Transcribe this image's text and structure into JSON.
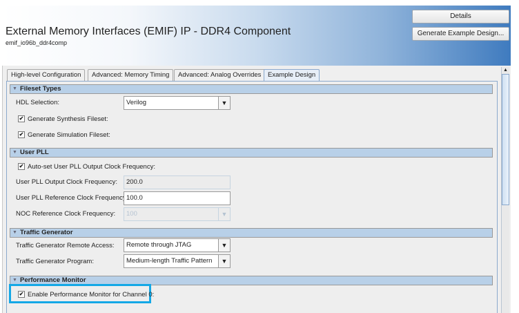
{
  "header": {
    "title": "External Memory Interfaces (EMIF) IP - DDR4 Component",
    "subtitle": "emif_io96b_ddr4comp",
    "details_button": "Details",
    "generate_button": "Generate Example Design..."
  },
  "tabs": [
    {
      "label": "High-level Configuration"
    },
    {
      "label": "Advanced: Memory Timing"
    },
    {
      "label": "Advanced: Analog Overrides"
    },
    {
      "label": "Example Design",
      "active": true
    }
  ],
  "sections": {
    "fileset": {
      "title": "Fileset Types",
      "hdl_label": "HDL Selection:",
      "hdl_value": "Verilog",
      "synth_label": "Generate Synthesis Fileset:",
      "synth_checked": true,
      "sim_label": "Generate Simulation Fileset:",
      "sim_checked": true
    },
    "pll": {
      "title": "User PLL",
      "autoset_label": "Auto-set User PLL Output Clock Frequency:",
      "autoset_checked": true,
      "out_label": "User PLL Output Clock Frequency:",
      "out_value": "200.0",
      "ref_label": "User PLL Reference Clock Frequency:",
      "ref_value": "100.0",
      "noc_label": "NOC Reference Clock Frequency:",
      "noc_value": "100"
    },
    "traffic": {
      "title": "Traffic Generator",
      "remote_label": "Traffic Generator Remote Access:",
      "remote_value": "Remote through JTAG",
      "program_label": "Traffic Generator Program:",
      "program_value": "Medium-length Traffic Pattern"
    },
    "perf": {
      "title": "Performance Monitor",
      "enable_label": "Enable Performance Monitor for Channel 0:",
      "enable_checked": true
    }
  },
  "check_glyph": "✔",
  "colors": {
    "highlight": "#14a8e6",
    "section_header": "#b8d0e8",
    "header_gradient_end": "#3f7bbf"
  }
}
